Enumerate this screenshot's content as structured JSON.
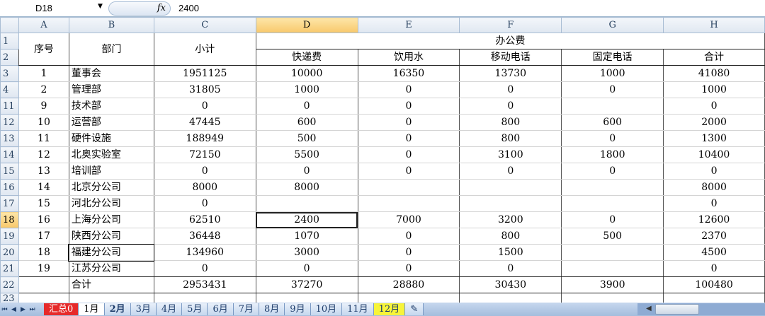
{
  "formula_bar": {
    "cell_ref": "D18",
    "fx_label": "fx",
    "value": "2400"
  },
  "columns": [
    "A",
    "B",
    "C",
    "D",
    "E",
    "F",
    "G",
    "H"
  ],
  "selected_column": "D",
  "header": {
    "seq": "序号",
    "dept": "部门",
    "subtotal": "小计",
    "office": "办公费",
    "sub": [
      "快递费",
      "饮用水",
      "移动电话",
      "固定电话",
      "合计"
    ]
  },
  "rows": [
    {
      "row": "3",
      "cells": [
        "1",
        "董事会",
        "1951125",
        "10000",
        "16350",
        "13730",
        "1000",
        "41080"
      ]
    },
    {
      "row": "4",
      "cells": [
        "2",
        "管理部",
        "31805",
        "1000",
        "0",
        "0",
        "0",
        "1000"
      ]
    },
    {
      "row": "11",
      "cells": [
        "9",
        "技术部",
        "0",
        "0",
        "0",
        "0",
        "",
        "0"
      ]
    },
    {
      "row": "12",
      "cells": [
        "10",
        "运营部",
        "47445",
        "600",
        "0",
        "800",
        "600",
        "2000"
      ]
    },
    {
      "row": "13",
      "cells": [
        "11",
        "硬件设施",
        "188949",
        "500",
        "0",
        "800",
        "0",
        "1300"
      ]
    },
    {
      "row": "14",
      "cells": [
        "12",
        "北奥实验室",
        "72150",
        "5500",
        "0",
        "3100",
        "1800",
        "10400"
      ]
    },
    {
      "row": "15",
      "cells": [
        "13",
        "培训部",
        "0",
        "0",
        "0",
        "0",
        "0",
        "0"
      ]
    },
    {
      "row": "16",
      "cells": [
        "14",
        "北京分公司",
        "8000",
        "8000",
        "",
        "",
        "",
        "8000"
      ]
    },
    {
      "row": "17",
      "cells": [
        "15",
        "河北分公司",
        "0",
        "",
        "",
        "",
        "",
        "0"
      ]
    },
    {
      "row": "18",
      "cells": [
        "16",
        "上海分公司",
        "62510",
        "2400",
        "7000",
        "3200",
        "0",
        "12600"
      ]
    },
    {
      "row": "19",
      "cells": [
        "17",
        "陕西分公司",
        "36448",
        "1070",
        "0",
        "800",
        "500",
        "2370"
      ]
    },
    {
      "row": "20",
      "cells": [
        "18",
        "福建分公司",
        "134960",
        "3000",
        "0",
        "1500",
        "",
        "4500"
      ]
    },
    {
      "row": "21",
      "cells": [
        "19",
        "江苏分公司",
        "0",
        "0",
        "0",
        "0",
        "",
        "0"
      ]
    },
    {
      "row": "22",
      "cells": [
        "",
        "合计",
        "2953431",
        "37270",
        "28880",
        "30430",
        "3900",
        "100480"
      ]
    },
    {
      "row": "23",
      "cells": [
        "",
        "",
        "",
        "",
        "",
        "",
        "",
        ""
      ]
    }
  ],
  "selected_row": "18",
  "sheet_tabs": [
    "汇总0",
    "1月",
    "2月",
    "3月",
    "4月",
    "5月",
    "6月",
    "7月",
    "8月",
    "9月",
    "10月",
    "11月",
    "12月"
  ],
  "active_tab": "1月"
}
